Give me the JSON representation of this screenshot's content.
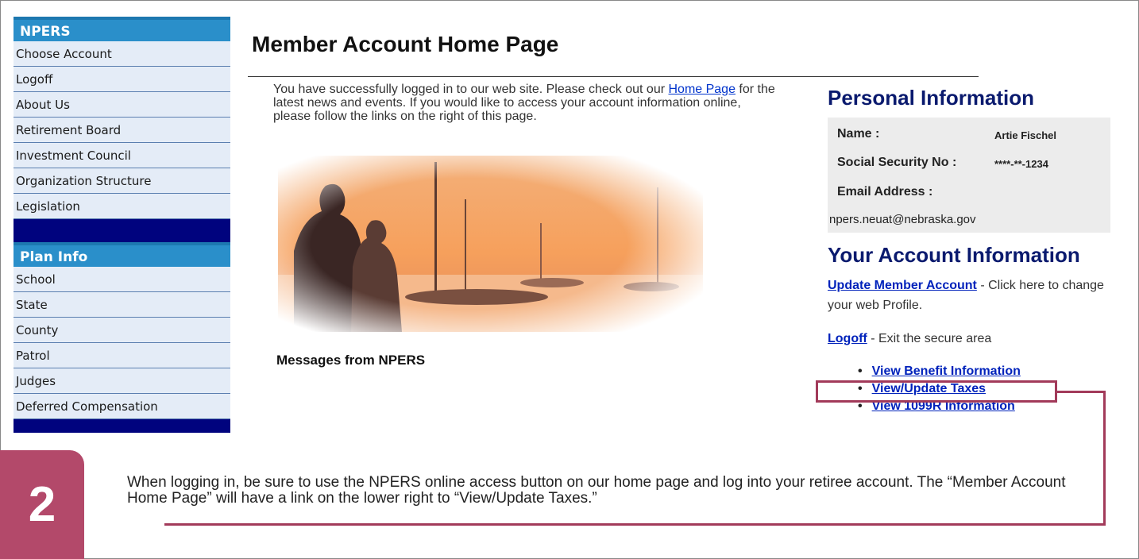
{
  "sidebar": {
    "section1": {
      "header": "NPERS",
      "items": [
        "Choose Account",
        "Logoff",
        "About Us",
        "Retirement Board",
        "Investment Council",
        "Organization Structure",
        "Legislation"
      ]
    },
    "section2": {
      "header": "Plan Info",
      "items": [
        "School",
        "State",
        "County",
        "Patrol",
        "Judges",
        "Deferred Compensation"
      ]
    }
  },
  "main": {
    "title": "Member Account Home Page",
    "intro_before": "You have successfully logged in to our web site. Please check out our ",
    "intro_link": "Home Page",
    "intro_after": " for the latest news and events. If you would like to access your account information online, please follow the links on the right of this page.",
    "messages_heading": "Messages from NPERS"
  },
  "personal": {
    "heading": "Personal Information",
    "name_label": "Name :",
    "name_value": "Artie Fischel",
    "ssn_label": "Social Security No :",
    "ssn_value": "****-**-1234",
    "email_label": "Email Address :",
    "email_value": "npers.neuat@nebraska.gov"
  },
  "account": {
    "heading": "Your Account Information",
    "update_link": "Update Member Account",
    "update_text": " - Click here to change your web Profile.",
    "logoff_link": "Logoff",
    "logoff_text": " - Exit the secure area",
    "links": [
      "View Benefit Information",
      "View/Update Taxes",
      "View 1099R Information"
    ]
  },
  "callout": {
    "step": "2",
    "text": "When logging in, be sure to use the NPERS online access button on our home page and log into your retiree account.  The “Member Account Home Page” will have a link on the lower right to “View/Update Taxes.”"
  },
  "colors": {
    "sidebar_header": "#2a8fca",
    "sidebar_separator": "#00037e",
    "sidebar_item_bg": "#e4ecf7",
    "heading_navy": "#0a1a6e",
    "link_blue": "#0022bb",
    "callout_accent": "#b3496a"
  }
}
